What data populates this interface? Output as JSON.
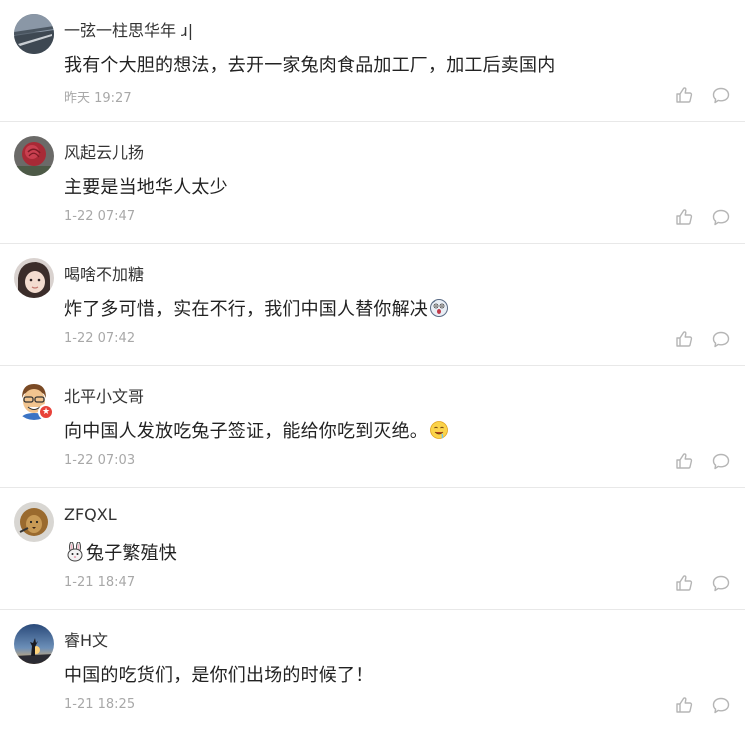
{
  "comments": [
    {
      "username": "一弦一柱思华年 ɹ|",
      "content": "我有个大胆的想法，去开一家兔肉食品加工厂，加工后卖国内",
      "timestamp": "昨天 19:27",
      "avatar_icon": "road-landscape-avatar"
    },
    {
      "username": "风起云儿扬",
      "content": "主要是当地华人太少",
      "timestamp": "1-22 07:47",
      "avatar_icon": "rose-avatar"
    },
    {
      "username": "喝啥不加糖",
      "content": "炸了多可惜，实在不行，我们中国人替你解决",
      "emoji_after": "shocked-face-emoji",
      "timestamp": "1-22 07:42",
      "avatar_icon": "child-portrait-avatar"
    },
    {
      "username": "北平小文哥",
      "content": "向中国人发放吃兔子签证，能给你吃到灭绝。",
      "emoji_after": "drooling-face-emoji",
      "timestamp": "1-22 07:03",
      "avatar_icon": "cartoon-man-avatar",
      "badge": "vip-badge"
    },
    {
      "username": "ZFQXL",
      "content": "兔子繁殖快",
      "emoji_before": "rabbit-emoji",
      "timestamp": "1-21 18:47",
      "avatar_icon": "lion-avatar"
    },
    {
      "username": "睿H文",
      "content": "中国的吃货们，是你们出场的时候了！",
      "timestamp": "1-21 18:25",
      "avatar_icon": "sunset-silhouette-avatar"
    }
  ],
  "colors": {
    "username": "#333333",
    "content": "#222222",
    "timestamp": "#a8a8a8",
    "icon": "#b5b5b5",
    "divider": "#e8e8e8",
    "badge": "#e8423a"
  }
}
